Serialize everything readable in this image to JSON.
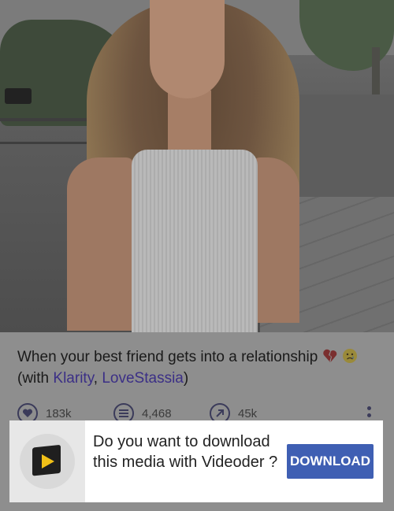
{
  "video": {
    "title": "When your best friend gets into a relationship",
    "with_prefix": "(with ",
    "collaborators": [
      "Klarity",
      "LoveStassia"
    ],
    "separator": ", ",
    "with_suffix": ")",
    "title_emojis": [
      "broken-heart-emoji",
      "crying-face-emoji"
    ]
  },
  "stats": {
    "likes": "183k",
    "comments": "4,468",
    "shares": "45k"
  },
  "banner": {
    "message": "Do you want to download this media with Videoder ?",
    "button_label": "DOWNLOAD",
    "app_icon": "videoder-logo"
  },
  "colors": {
    "accent_blue": "#3f5fb3",
    "link_purple": "#3b2f86",
    "videoder_yellow": "#f0c018"
  }
}
